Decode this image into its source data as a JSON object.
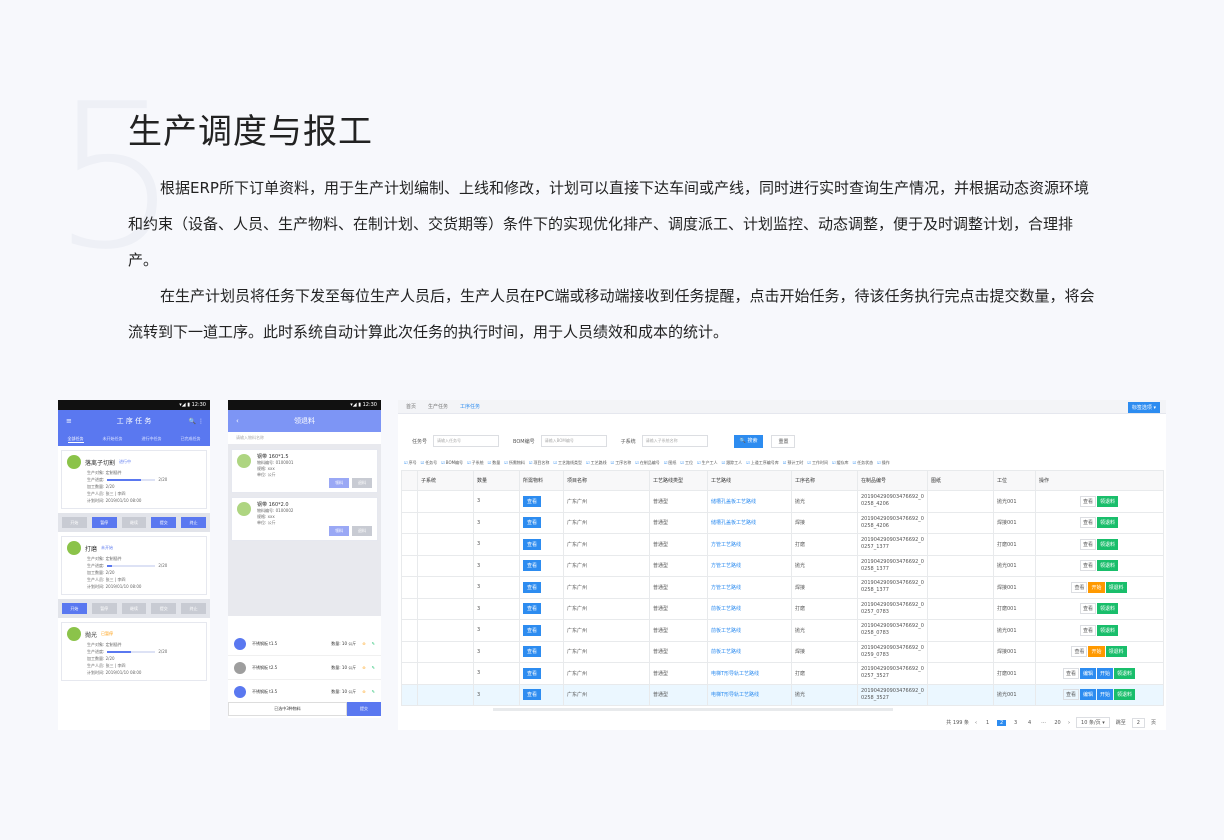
{
  "section_number": "5",
  "title": "生产调度与报工",
  "paragraphs": [
    "根据ERP所下订单资料，用于生产计划编制、上线和修改，计划可以直接下达车间或产线，同时进行实时查询生产情况，并根据动态资源环境和约束（设备、人员、生产物料、在制计划、交货期等）条件下的实现优化排产、调度派工、计划监控、动态调整，便于及时调整计划，合理排产。",
    "在生产计划员将任务下发至每位生产人员后，生产人员在PC端或移动端接收到任务提醒，点击开始任务，待该任务执行完点击提交数量，将会流转到下一道工序。此时系统自动计算此次任务的执行时间，用于人员绩效和成本的统计。"
  ],
  "phone1": {
    "status": "▾◢ ▮ 12:30",
    "title": "工 序 任 务",
    "tabs": [
      "全部任务",
      "未开始任务",
      "进行中任务",
      "已完成任务"
    ],
    "cards": [
      {
        "title": "落离子切割",
        "state": "进行中",
        "lines": [
          "生产对象: 定制插件",
          "生产进度:",
          "加工数量: 2/20",
          "生产人员: 张三 | 李四",
          "计划时间: 2019/01/10 08:00"
        ],
        "progress": 0.7,
        "progress_text": "2/20"
      },
      {
        "title": "打磨",
        "state": "未开始",
        "lines": [
          "生产对象: 定制插件",
          "生产进度:",
          "加工数量: 2/20",
          "生产人员: 张三 | 李四",
          "计划时间: 2019/01/10 08:00"
        ],
        "progress": 0.1,
        "progress_text": "2/20"
      },
      {
        "title": "抛光",
        "state": "已暂停",
        "lines": [
          "生产对象: 定制插件",
          "生产进度:",
          "加工数量: 2/20",
          "生产人员: 张三 | 李四",
          "计划时间: 2019/01/10 08:00"
        ],
        "progress": 0.5,
        "progress_text": "2/20"
      }
    ],
    "buttons1": [
      "开始",
      "暂停",
      "继续",
      "提交",
      "终止"
    ],
    "buttons2": [
      "开始",
      "暂停",
      "继续",
      "提交",
      "终止"
    ]
  },
  "phone2": {
    "status": "▾◢ ▮ 12:30",
    "title": "领退料",
    "back": "‹",
    "search_hint": "请输入物料名称",
    "items": [
      {
        "name": "钢带 160*1.5",
        "lines": [
          "物料编号: 0100001",
          "规格: xxx",
          "单位: 公斤"
        ],
        "b1": "领料",
        "b2": "退料"
      },
      {
        "name": "钢带 160*2.0",
        "lines": [
          "物料编号: 0100002",
          "规格: xxx",
          "单位: 公斤"
        ],
        "b1": "领料",
        "b2": "退料"
      }
    ],
    "materials": [
      {
        "name": "不锈钢板 t1.5",
        "qty": "数量: 10 公斤"
      },
      {
        "name": "不锈钢板 t2.5",
        "qty": "数量: 10 公斤"
      },
      {
        "name": "不锈钢板 t3.5",
        "qty": "数量: 10 公斤"
      }
    ],
    "foot_left": "已选中3种物料",
    "foot_right": "提交"
  },
  "desktop": {
    "tabs": [
      "首页",
      "生产任务",
      "工序任务"
    ],
    "color_button": "标签选项 ▾",
    "search": [
      {
        "label": "任务号",
        "placeholder": "请输入任务号"
      },
      {
        "label": "BOM编号",
        "placeholder": "请输入BOM编号"
      },
      {
        "label": "子系统",
        "placeholder": "请输入子系统名称"
      }
    ],
    "search_btn": "🔍 搜索",
    "reset_btn": "重置",
    "column_toggles": [
      "序号",
      "任务号",
      "BOM编号",
      "子系统",
      "数量",
      "所需物料",
      "项目名称",
      "工艺路线类型",
      "工艺路线",
      "工序名称",
      "在制品编号",
      "图纸",
      "工位",
      "生产工人",
      "跟踪工人",
      "上道工序编号库",
      "预计工时",
      "工作时间",
      "缓存库",
      "任务状态",
      "操作"
    ],
    "headers": [
      "",
      "子系统",
      "数量",
      "所需物料",
      "项目名称",
      "工艺路线类型",
      "工艺路线",
      "工序名称",
      "在制品编号",
      "图纸",
      "工位",
      "操作"
    ],
    "rows": [
      {
        "sub": "",
        "qty": "3",
        "mat": "查看",
        "proj": "广东广州",
        "type": "普通型",
        "route": "储槽孔盖板工艺路线",
        "proc": "抛光",
        "code": "201904290903476692_00258_4206",
        "pos": "抛光001",
        "ops": [
          "查看",
          "领退料"
        ]
      },
      {
        "sub": "",
        "qty": "3",
        "mat": "查看",
        "proj": "广东广州",
        "type": "普通型",
        "route": "储槽孔盖板工艺路线",
        "proc": "焊接",
        "code": "201904290903476692_00258_4206",
        "pos": "焊接001",
        "ops": [
          "查看",
          "领退料"
        ]
      },
      {
        "sub": "",
        "qty": "3",
        "mat": "查看",
        "proj": "广东广州",
        "type": "普通型",
        "route": "方管工艺路线",
        "proc": "打磨",
        "code": "201904290903476692_00257_1377",
        "pos": "打磨001",
        "ops": [
          "查看",
          "领退料"
        ]
      },
      {
        "sub": "",
        "qty": "3",
        "mat": "查看",
        "proj": "广东广州",
        "type": "普通型",
        "route": "方管工艺路线",
        "proc": "抛光",
        "code": "201904290903476692_00258_1377",
        "pos": "抛光001",
        "ops": [
          "查看",
          "领退料"
        ]
      },
      {
        "sub": "",
        "qty": "3",
        "mat": "查看",
        "proj": "广东广州",
        "type": "普通型",
        "route": "方管工艺路线",
        "proc": "焊接",
        "code": "201904290903476692_00258_1377",
        "pos": "焊接001",
        "ops": [
          "查看",
          "开始",
          "领退料"
        ]
      },
      {
        "sub": "",
        "qty": "3",
        "mat": "查看",
        "proj": "广东广州",
        "type": "普通型",
        "route": "前板工艺路线",
        "proc": "打磨",
        "code": "201904290903476692_00257_0783",
        "pos": "打磨001",
        "ops": [
          "查看",
          "领退料"
        ]
      },
      {
        "sub": "",
        "qty": "3",
        "mat": "查看",
        "proj": "广东广州",
        "type": "普通型",
        "route": "前板工艺路线",
        "proc": "抛光",
        "code": "201904290903476692_00258_0783",
        "pos": "抛光001",
        "ops": [
          "查看",
          "领退料"
        ]
      },
      {
        "sub": "",
        "qty": "3",
        "mat": "查看",
        "proj": "广东广州",
        "type": "普通型",
        "route": "前板工艺路线",
        "proc": "焊接",
        "code": "201904290903476692_00259_0783",
        "pos": "焊接001",
        "ops": [
          "查看",
          "开始",
          "领退料"
        ]
      },
      {
        "sub": "",
        "qty": "3",
        "mat": "查看",
        "proj": "广东广州",
        "type": "普通型",
        "route": "电梯T形导轨工艺路线",
        "proc": "打磨",
        "code": "201904290903476692_00257_3527",
        "pos": "打磨001",
        "ops": [
          "查看",
          "编辑",
          "开始",
          "领退料"
        ]
      },
      {
        "sub": "",
        "qty": "3",
        "mat": "查看",
        "proj": "广东广州",
        "type": "普通型",
        "route": "电梯T形导轨工艺路线",
        "proc": "抛光",
        "code": "201904290903476692_00258_3527",
        "pos": "抛光001",
        "ops": [
          "查看",
          "编辑",
          "开始",
          "领退料"
        ]
      }
    ],
    "pager": {
      "total": "共 199 条",
      "prev": "‹",
      "pages": [
        "1",
        "2",
        "3",
        "4",
        "···",
        "20"
      ],
      "current": "2",
      "next": "›",
      "size": "10 条/页 ▾",
      "jump": "跳至",
      "jump_val": "2",
      "page_unit": "页"
    }
  }
}
